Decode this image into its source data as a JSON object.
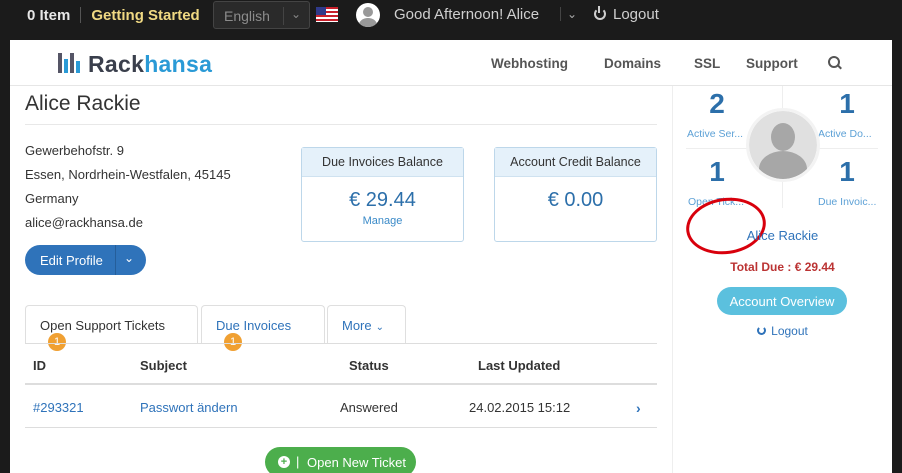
{
  "topbar": {
    "cart": "0 Item",
    "getting_started": "Getting Started",
    "language": "English",
    "greeting": "Good Afternoon! Alice",
    "logout": "Logout"
  },
  "header": {
    "brand_part1": "Rack",
    "brand_part2": "hansa",
    "nav": [
      "Webhosting",
      "Domains",
      "SSL",
      "Support"
    ]
  },
  "client": {
    "name": "Alice Rackie",
    "address": [
      "Gewerbehofstr. 9",
      "Essen, Nordrhein-Westfalen, 45145",
      "Germany",
      "alice@rackhansa.de"
    ],
    "edit_profile": "Edit Profile"
  },
  "boxes": {
    "due_title": "Due Invoices Balance",
    "due_value": "€ 29.44",
    "due_manage": "Manage",
    "credit_title": "Account Credit Balance",
    "credit_value": "€ 0.00"
  },
  "tabs": {
    "open_tickets": "Open Support Tickets",
    "open_tickets_count": "1",
    "due_invoices": "Due Invoices",
    "due_invoices_count": "1",
    "more": "More"
  },
  "table": {
    "headers": [
      "ID",
      "Subject",
      "Status",
      "Last Updated"
    ],
    "rows": [
      {
        "id": "#293321",
        "subject": "Passwort ändern",
        "status": "Answered",
        "updated": "24.02.2015 15:12"
      }
    ]
  },
  "buttons": {
    "open_new_ticket": "Open New Ticket"
  },
  "sidebar": {
    "active_services": "2",
    "active_services_label": "Active Ser...",
    "active_domains": "1",
    "active_domains_label": "Active Do...",
    "open_tickets": "1",
    "open_tickets_label": "Open Tick...",
    "due_invoices": "1",
    "due_invoices_label": "Due Invoic...",
    "name": "Alice Rackie",
    "total_due": "Total Due : € 29.44",
    "account_overview": "Account Overview",
    "logout": "Logout"
  },
  "colors": {
    "brand_blue": "#2f73ba",
    "accent_cyan": "#5bc0de",
    "success_green": "#4cae4c",
    "badge_orange": "#f0a032",
    "highlight_red": "#d8000c"
  }
}
